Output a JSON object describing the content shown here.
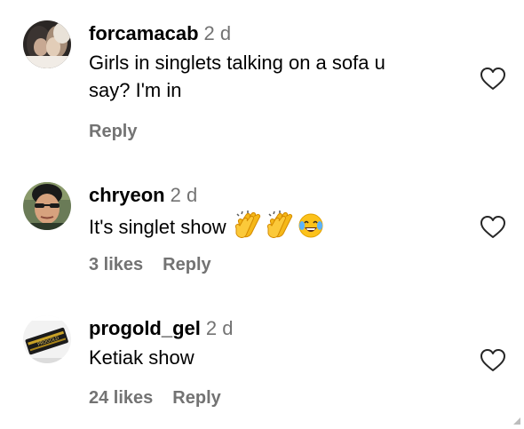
{
  "comments": [
    {
      "username": "forcamacab",
      "time": "2 d",
      "text_line1": "Girls in singlets talking on a sofa u",
      "text_line2": "say? I'm in",
      "likes": "",
      "reply_label": "Reply",
      "avatar_icon": "couple-photo-avatar",
      "heart_icon": "heart-outline-icon"
    },
    {
      "username": "chryeon",
      "time": "2 d",
      "text": "It's singlet show",
      "emojis": [
        "clapping-hands-emoji",
        "clapping-hands-emoji",
        "tears-of-joy-emoji"
      ],
      "likes": "3 likes",
      "reply_label": "Reply",
      "avatar_icon": "man-with-glasses-avatar",
      "heart_icon": "heart-outline-icon"
    },
    {
      "username": "progold_gel",
      "time": "2 d",
      "text": "Ketiak show",
      "likes": "24 likes",
      "reply_label": "Reply",
      "avatar_icon": "product-box-avatar",
      "heart_icon": "heart-outline-icon"
    }
  ],
  "colors": {
    "text": "#000000",
    "secondary": "#737373",
    "background": "#ffffff"
  }
}
